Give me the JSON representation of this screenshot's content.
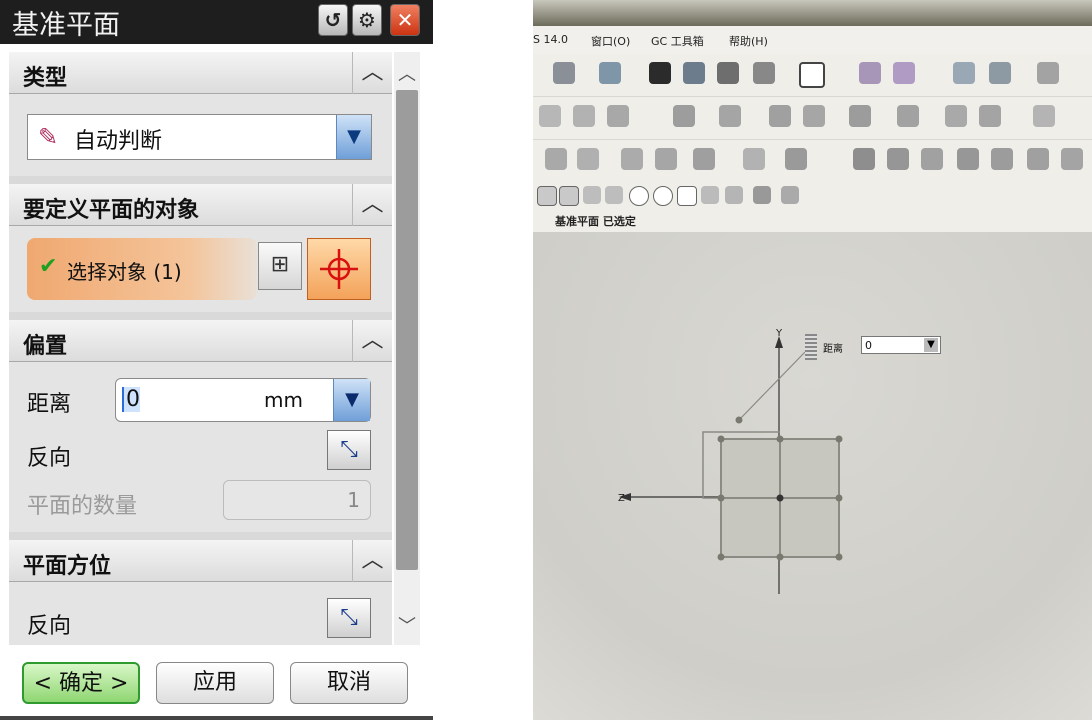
{
  "dialog": {
    "title": "基准平面",
    "title_buttons": {
      "reset": "↺",
      "settings": "⚙",
      "close": "✕"
    },
    "sections": {
      "type": {
        "label": "类型",
        "selected": "自动判断",
        "icon": "auto-infer-icon"
      },
      "objects": {
        "label": "要定义平面的对象",
        "select_label": "选择对象 (1)"
      },
      "offset": {
        "label": "偏置",
        "distance_label": "距离",
        "distance_value": "0",
        "distance_unit": "mm",
        "reverse_label": "反向",
        "count_label": "平面的数量",
        "count_value": "1"
      },
      "orientation": {
        "label": "平面方位",
        "reverse_label": "反向"
      }
    },
    "footer": {
      "ok": "< 确定 >",
      "apply": "应用",
      "cancel": "取消"
    }
  },
  "nx": {
    "menu": [
      "S 14.0",
      "窗口(O)",
      "GC 工具箱",
      "帮助(H)"
    ],
    "status": "基准平面 已选定",
    "distance_popup": {
      "label": "距离",
      "value": "0"
    },
    "axes": {
      "y": "Y",
      "z": "Z"
    }
  },
  "colors": {
    "title_bar": "#1e1e1e",
    "selection_highlight": "#f0a870",
    "ok_button": "#8fd672",
    "canvas": "#d6d5cf"
  }
}
